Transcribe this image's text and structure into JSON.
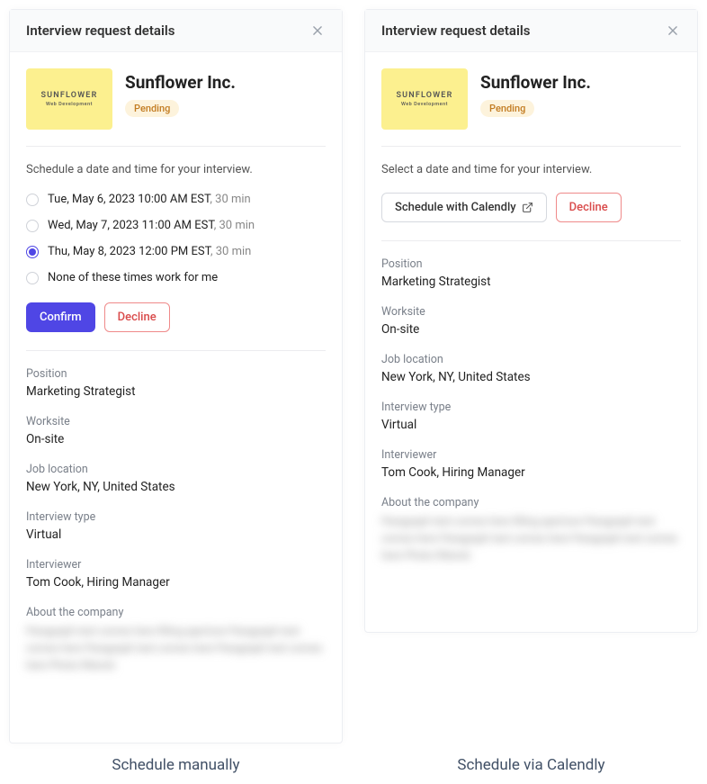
{
  "header_title": "Interview request details",
  "company": {
    "logo_main": "SUNFLOWER",
    "logo_sub": "Web Development",
    "name": "Sunflower Inc.",
    "status": "Pending"
  },
  "manual": {
    "instruction": "Schedule a date and time for your interview.",
    "options": [
      {
        "label": "Tue, May 6, 2023 10:00 AM EST",
        "duration": ", 30 min",
        "selected": false
      },
      {
        "label": "Wed, May 7, 2023 11:00 AM EST",
        "duration": ", 30 min",
        "selected": false
      },
      {
        "label": "Thu, May 8, 2023 12:00 PM EST",
        "duration": ", 30 min",
        "selected": true
      },
      {
        "label": "None of these times work for me",
        "duration": "",
        "selected": false
      }
    ],
    "confirm": "Confirm",
    "decline": "Decline",
    "caption": "Schedule manually"
  },
  "calendly": {
    "instruction": "Select a date and time for your interview.",
    "schedule_btn": "Schedule with Calendly",
    "decline": "Decline",
    "caption": "Schedule via Calendly"
  },
  "details": {
    "position_label": "Position",
    "position_value": "Marketing Strategist",
    "worksite_label": "Worksite",
    "worksite_value": "On-site",
    "location_label": "Job location",
    "location_value": "New York, NY, United States",
    "type_label": "Interview type",
    "type_value": "Virtual",
    "interviewer_label": "Interviewer",
    "interviewer_value": "Tom Cook, Hiring Manager",
    "about_label": "About the company",
    "about_value": "Paragraph text comes here filling aperture Paragraph text comes here Paragraph text comes here Paragraph text comes here Photo filtered."
  }
}
